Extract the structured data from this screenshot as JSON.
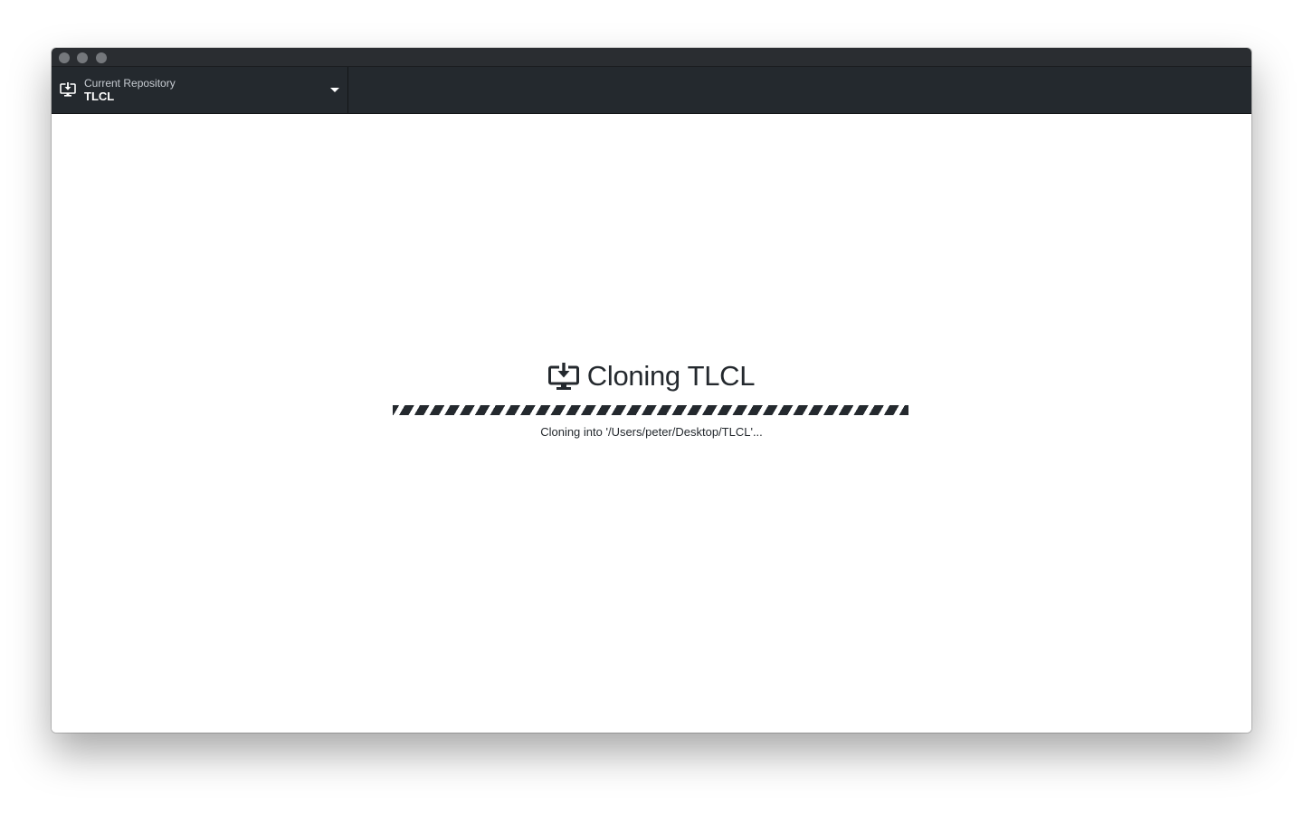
{
  "window": {
    "traffic_lights": [
      "close",
      "minimize",
      "zoom"
    ]
  },
  "toolbar": {
    "repository": {
      "caption": "Current Repository",
      "name": "TLCL",
      "icon": "clone-icon",
      "dropdown_icon": "caret-down-icon"
    }
  },
  "main": {
    "title": "Cloning TLCL",
    "title_icon": "clone-icon",
    "progress": {
      "state": "indeterminate"
    },
    "status": "Cloning into '/Users/peter/Desktop/TLCL'..."
  },
  "colors": {
    "toolbar_bg": "#24292e",
    "titlebar_bg": "#2a2d31",
    "text_dark": "#24292e",
    "caption_text": "#c6cbd1"
  }
}
